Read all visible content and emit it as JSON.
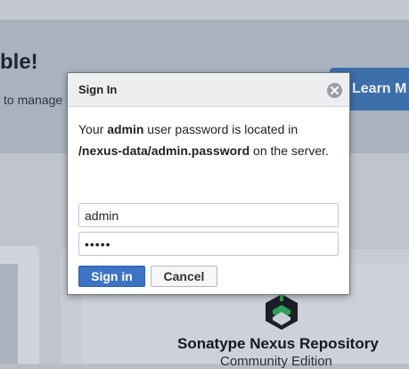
{
  "background": {
    "headline": "ble!",
    "subtext": "to manage",
    "learn_button": "Learn M",
    "brand_title": "Sonatype Nexus Repository",
    "brand_subtitle": "Community Edition"
  },
  "dialog": {
    "title": "Sign In",
    "message": {
      "prefix": "Your ",
      "user_bold": "admin",
      "middle": " user password is located in",
      "path_bold": "/nexus-data/admin.password",
      "suffix": " on the server."
    },
    "username_value": "admin",
    "password_value": "admin",
    "signin_label": "Sign in",
    "cancel_label": "Cancel"
  },
  "colors": {
    "primary_button": "#3d73c4",
    "dialog_header": "#eceef0",
    "overlay_page": "#b9bec5"
  },
  "icons": {
    "close": "close-circle-icon",
    "logo": "sonatype-logo-icon"
  }
}
